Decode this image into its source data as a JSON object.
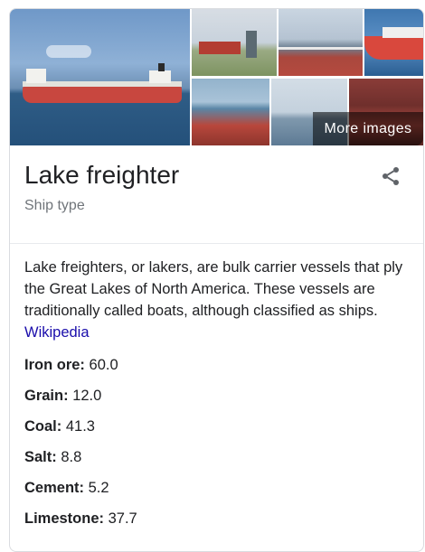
{
  "gallery": {
    "more_images_label": "More images"
  },
  "entity": {
    "title": "Lake freighter",
    "subtitle": "Ship type"
  },
  "description": {
    "text": "Lake freighters, or lakers, are bulk carrier vessels that ply the Great Lakes of North America. These vessels are traditionally called boats, although classified as ships.",
    "source_link": "Wikipedia"
  },
  "facts": [
    {
      "label": "Iron ore:",
      "value": "60.0"
    },
    {
      "label": "Grain:",
      "value": "12.0"
    },
    {
      "label": "Coal:",
      "value": "41.3"
    },
    {
      "label": "Salt:",
      "value": "8.8"
    },
    {
      "label": "Cement:",
      "value": "5.2"
    },
    {
      "label": "Limestone:",
      "value": "37.7"
    }
  ],
  "icons": {
    "share": "share-icon"
  }
}
